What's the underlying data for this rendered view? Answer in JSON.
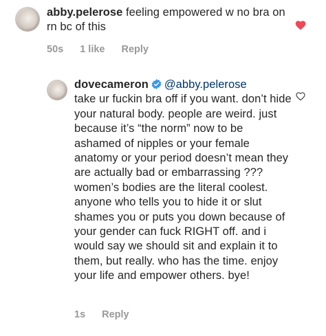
{
  "comment": {
    "username": "abby.pelerose",
    "text": " feeling empowered w no bra on rn bc of this",
    "time": "50s",
    "likes": "1 like",
    "reply_label": "Reply",
    "liked": true
  },
  "reply": {
    "username": "dovecameron",
    "mention": "@abby.pelerose",
    "text": "take ur fuckin bra off if you want. don’t hide your natural body. people are weird. just because it’s “the norm” now to be ashamed of nipples or your female anatomy or your period doesn’t mean they are actually bad or embarrassing ??? women’s bodies are the literal coolest. anyone who tells you to hide it or slut shames you or puts you down because of your gender can fuck RIGHT off. and i would say we should sit and explain it to them, but really. who has the time. enjoy your life and empower others. bye!",
    "time": "1s",
    "reply_label": "Reply",
    "verified": true
  },
  "colors": {
    "heart": "#ed4956",
    "verified": "#3897f0",
    "meta": "#999999",
    "text": "#262626",
    "mention": "#003569"
  }
}
